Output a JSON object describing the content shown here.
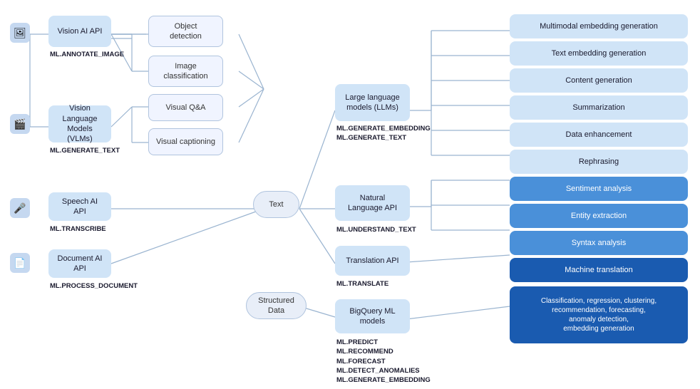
{
  "nodes": {
    "vision_ai": {
      "label": "Vision AI API",
      "sub": "ML.ANNOTATE_IMAGE"
    },
    "vision_lang": {
      "label": "Vision Language\nModels (VLMs)",
      "sub": "ML.GENERATE_TEXT"
    },
    "speech_ai": {
      "label": "Speech AI API",
      "sub": "ML.TRANSCRIBE"
    },
    "document_ai": {
      "label": "Document AI API",
      "sub": "ML.PROCESS_DOCUMENT"
    },
    "obj_detect": {
      "label": "Object\ndetection"
    },
    "img_class": {
      "label": "Image\nclassification"
    },
    "visual_qa": {
      "label": "Visual Q&A"
    },
    "visual_cap": {
      "label": "Visual captioning"
    },
    "text_node": {
      "label": "Text"
    },
    "struct_data": {
      "label": "Structured Data"
    },
    "llm": {
      "label": "Large language\nmodels (LLMs)",
      "sub": "ML.GENERATE_EMBEDDING\nML.GENERATE_TEXT"
    },
    "nlp_api": {
      "label": "Natural\nLanguage API",
      "sub": "ML.UNDERSTAND_TEXT"
    },
    "translation_api": {
      "label": "Translation API",
      "sub": "ML.TRANSLATE"
    },
    "bigquery_ml": {
      "label": "BigQuery ML\nmodels",
      "sub": "ML.PREDICT\nML.RECOMMEND\nML.FORECAST\nML.DETECT_ANOMALIES\nML.GENERATE_EMBEDDING"
    },
    "multimodal": {
      "label": "Multimodal embedding generation"
    },
    "text_embed": {
      "label": "Text embedding generation"
    },
    "content_gen": {
      "label": "Content generation"
    },
    "summarize": {
      "label": "Summarization"
    },
    "data_enhance": {
      "label": "Data enhancement"
    },
    "rephrase": {
      "label": "Rephrasing"
    },
    "sentiment": {
      "label": "Sentiment analysis"
    },
    "entity": {
      "label": "Entity extraction"
    },
    "syntax": {
      "label": "Syntax analysis"
    },
    "machine_trans": {
      "label": "Machine translation"
    },
    "classification": {
      "label": "Classification, regression, clustering,\nrecommendation, forecasting,\nanomaly detection,\nembedding generation"
    }
  }
}
